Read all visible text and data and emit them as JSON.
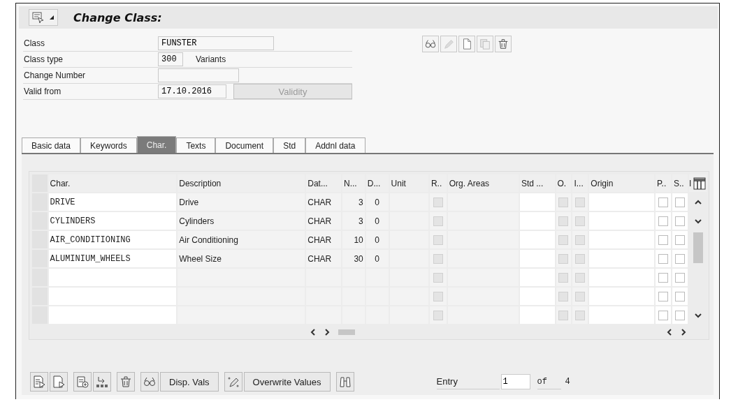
{
  "window": {
    "title": "Change Class:"
  },
  "form": [
    {
      "label": "Class",
      "value": "FUNSTER",
      "kind": "mono-wide"
    },
    {
      "label": "Class type",
      "value": "300",
      "kind": "short",
      "extra": "Variants"
    },
    {
      "label": "Change Number",
      "kind": "medium"
    },
    {
      "label": "Valid from",
      "value": "17.10.2016",
      "kind": "date",
      "button": {
        "label": "Validity",
        "disabled": true
      }
    }
  ],
  "tabs": [
    {
      "label": "Basic data",
      "selected": false
    },
    {
      "label": "Keywords",
      "selected": false
    },
    {
      "label": "Char.",
      "selected": true
    },
    {
      "label": "Texts",
      "selected": false
    },
    {
      "label": "Document",
      "selected": false
    },
    {
      "label": "Std",
      "selected": false
    },
    {
      "label": "Addnl data",
      "selected": false
    }
  ],
  "table": {
    "columns": [
      {
        "label": "Char.",
        "kind": "mono",
        "editable": true
      },
      {
        "label": "Description",
        "kind": "text",
        "editable": false
      },
      {
        "label": "Dat...",
        "kind": "text",
        "editable": false
      },
      {
        "label": "N...",
        "kind": "number",
        "editable": false
      },
      {
        "label": "D...",
        "kind": "center",
        "editable": false
      },
      {
        "label": "Unit",
        "kind": "text",
        "editable": false
      },
      {
        "label": "R..",
        "kind": "check",
        "editable": false
      },
      {
        "label": "Org. Areas",
        "kind": "text",
        "editable": false
      },
      {
        "label": "Std ...",
        "kind": "text",
        "editable": true
      },
      {
        "label": "O.",
        "kind": "check",
        "editable": false
      },
      {
        "label": "I...",
        "kind": "check",
        "editable": false
      },
      {
        "label": "Origin",
        "kind": "text",
        "editable": true
      },
      {
        "label": "P..",
        "kind": "check",
        "editable": true
      },
      {
        "label": "S..",
        "kind": "check",
        "editable": true
      }
    ],
    "column_15": "I",
    "rows": [
      {
        "cells": [
          "DRIVE",
          "Drive",
          "CHAR",
          "3",
          "0"
        ],
        "checks": [
          false,
          false,
          false,
          false,
          false
        ]
      },
      {
        "cells": [
          "CYLINDERS",
          "Cylinders",
          "CHAR",
          "3",
          "0"
        ],
        "checks": [
          false,
          false,
          false,
          false,
          false
        ]
      },
      {
        "cells": [
          "AIR_CONDITIONING",
          "Air Conditioning",
          "CHAR",
          "10",
          "0"
        ],
        "checks": [
          false,
          false,
          false,
          false,
          false
        ]
      },
      {
        "cells": [
          "ALUMINIUM_WHEELS",
          "Wheel Size",
          "CHAR",
          "30",
          "0"
        ],
        "checks": [
          false,
          false,
          false,
          false,
          false
        ]
      },
      {
        "checks": [
          false,
          false,
          false,
          false,
          false
        ]
      },
      {
        "checks": [
          false,
          false,
          false,
          false,
          false
        ]
      },
      {
        "checks": [
          false,
          false,
          false,
          false,
          false
        ]
      }
    ]
  },
  "bottom": {
    "buttons": [
      {
        "label": "Disp. Vals"
      },
      {
        "label": "Overwrite Values"
      }
    ],
    "entry_label": "Entry",
    "entry_value": "1",
    "of_label": "of",
    "total": "4"
  }
}
